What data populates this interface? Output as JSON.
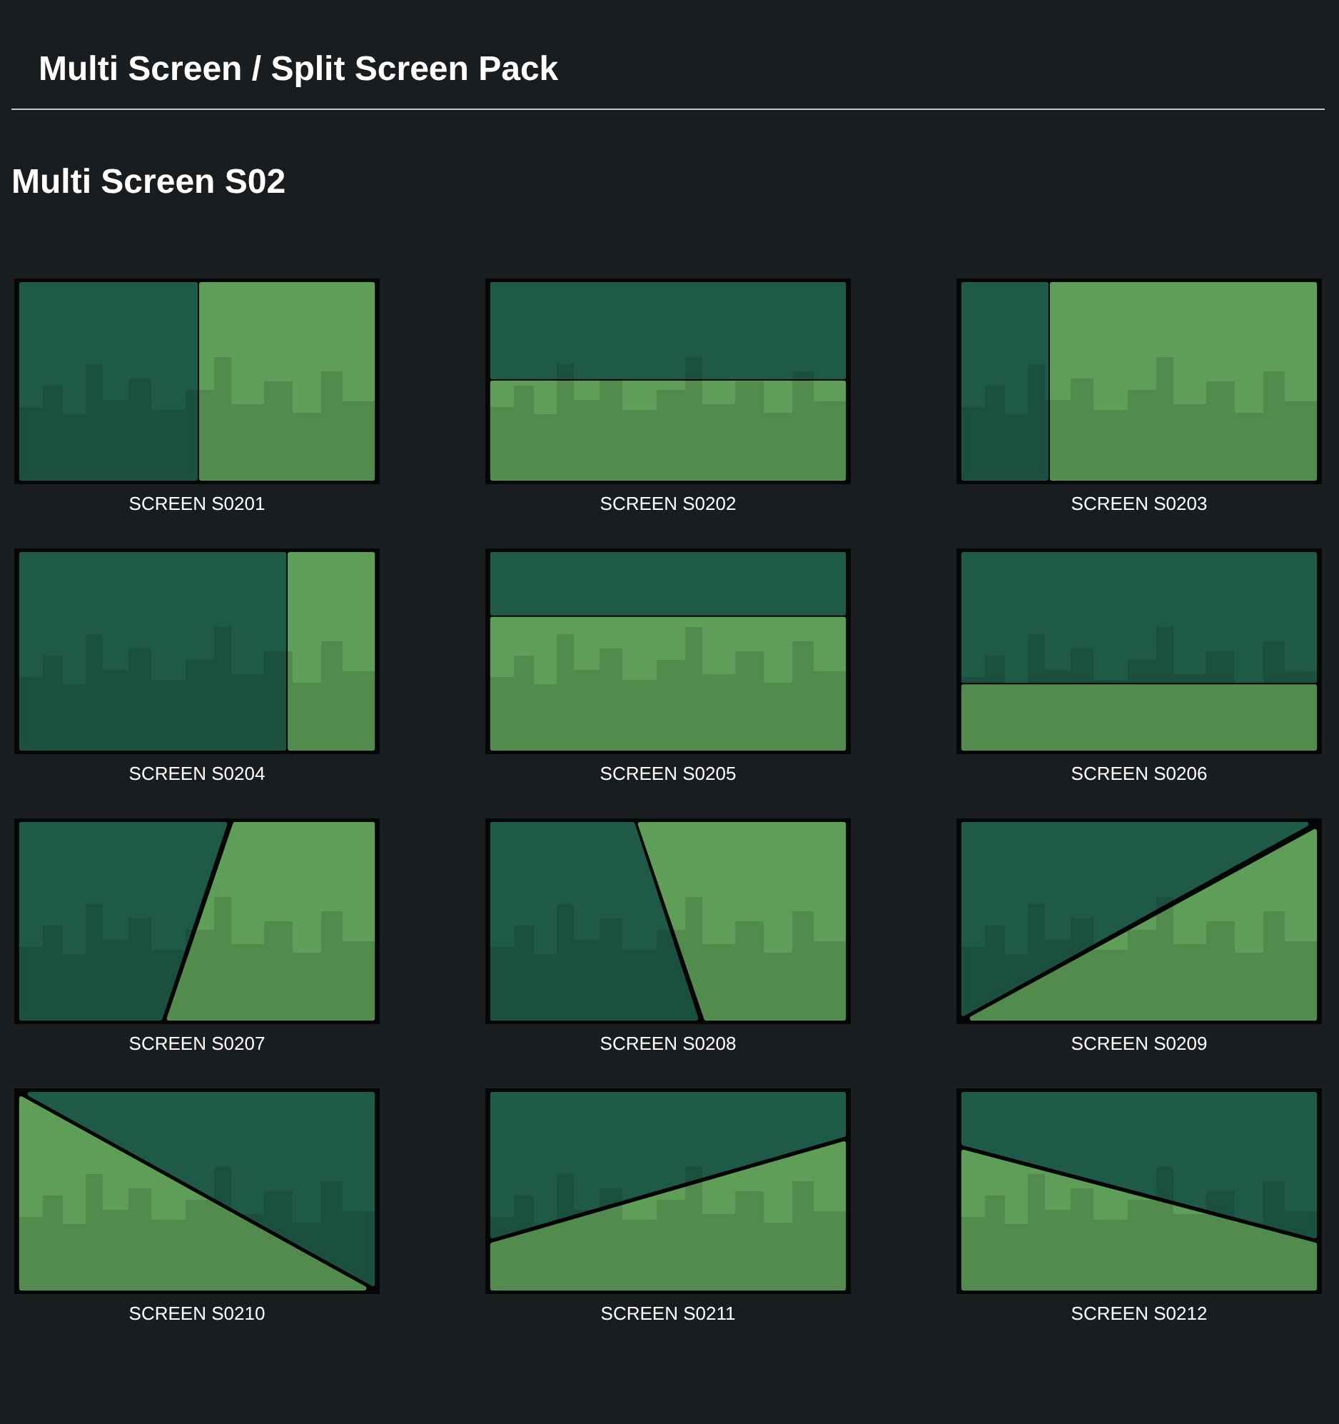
{
  "header": {
    "title": "Multi Screen / Split Screen Pack"
  },
  "section": {
    "title": "Multi Screen S02"
  },
  "items": [
    {
      "kind": "picture",
      "caption": "SCREEN S0201"
    },
    {
      "kind": "picture",
      "caption": "SCREEN S0202"
    },
    {
      "kind": "picture",
      "caption": "SCREEN S0203"
    },
    {
      "kind": "picture",
      "caption": "SCREEN S0204"
    },
    {
      "kind": "picture",
      "caption": "SCREEN S0205"
    },
    {
      "kind": "picture",
      "caption": "SCREEN S0206"
    },
    {
      "kind": "picture",
      "caption": "SCREEN S0207"
    },
    {
      "kind": "picture",
      "caption": "SCREEN S0208"
    },
    {
      "kind": "picture",
      "caption": "SCREEN S0209"
    },
    {
      "kind": "picture",
      "caption": "SCREEN S0210"
    },
    {
      "kind": "picture",
      "caption": "SCREEN S0211"
    },
    {
      "kind": "picture",
      "caption": "SCREEN S0212"
    }
  ]
}
